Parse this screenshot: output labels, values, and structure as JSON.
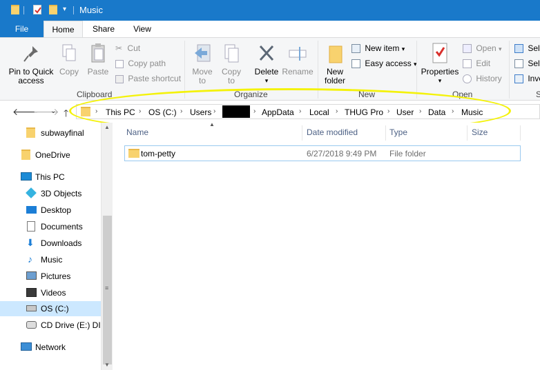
{
  "window": {
    "title": "Music"
  },
  "menu_tabs": {
    "file": "File",
    "home": "Home",
    "share": "Share",
    "view": "View"
  },
  "ribbon": {
    "clipboard": {
      "label": "Clipboard",
      "pin_line1": "Pin to Quick",
      "pin_line2": "access",
      "copy": "Copy",
      "paste": "Paste",
      "cut": "Cut",
      "copy_path": "Copy path",
      "paste_shortcut": "Paste shortcut"
    },
    "organize": {
      "label": "Organize",
      "move_line1": "Move",
      "move_line2": "to",
      "copy_line1": "Copy",
      "copy_line2": "to",
      "delete": "Delete",
      "rename": "Rename"
    },
    "new": {
      "label": "New",
      "new_folder_line1": "New",
      "new_folder_line2": "folder",
      "new_item": "New item",
      "easy_access": "Easy access"
    },
    "open": {
      "label": "Open",
      "properties": "Properties",
      "open": "Open",
      "edit": "Edit",
      "history": "History"
    },
    "select": {
      "label": "S",
      "select_all": "Sele",
      "select_none": "Sele",
      "invert": "Inve"
    }
  },
  "address": {
    "crumbs": [
      "This PC",
      "OS (C:)",
      "Users",
      "",
      "AppData",
      "Local",
      "THUG Pro",
      "User",
      "Data",
      "Music"
    ]
  },
  "nav": {
    "items": [
      {
        "label": "subwayfinal",
        "icon": "folder-icon"
      },
      {
        "label": "OneDrive",
        "icon": "folder-icon"
      },
      {
        "label": "This PC",
        "icon": "monitor-icon"
      },
      {
        "label": "3D Objects",
        "icon": "cube-icon"
      },
      {
        "label": "Desktop",
        "icon": "desktop-icon"
      },
      {
        "label": "Documents",
        "icon": "document-icon"
      },
      {
        "label": "Downloads",
        "icon": "download-icon"
      },
      {
        "label": "Music",
        "icon": "music-icon"
      },
      {
        "label": "Pictures",
        "icon": "pictures-icon"
      },
      {
        "label": "Videos",
        "icon": "videos-icon"
      },
      {
        "label": "OS (C:)",
        "icon": "drive-icon"
      },
      {
        "label": "CD Drive (E:) DIS",
        "icon": "cd-drive-icon"
      },
      {
        "label": "Network",
        "icon": "network-icon"
      }
    ]
  },
  "files": {
    "columns": {
      "name": "Name",
      "date": "Date modified",
      "type": "Type",
      "size": "Size"
    },
    "rows": [
      {
        "name": "tom-petty",
        "date": "6/27/2018 9:49 PM",
        "type": "File folder",
        "size": ""
      }
    ]
  },
  "colors": {
    "accent": "#1979ca",
    "highlight": "#f4f20a",
    "selected": "#cce8ff"
  }
}
